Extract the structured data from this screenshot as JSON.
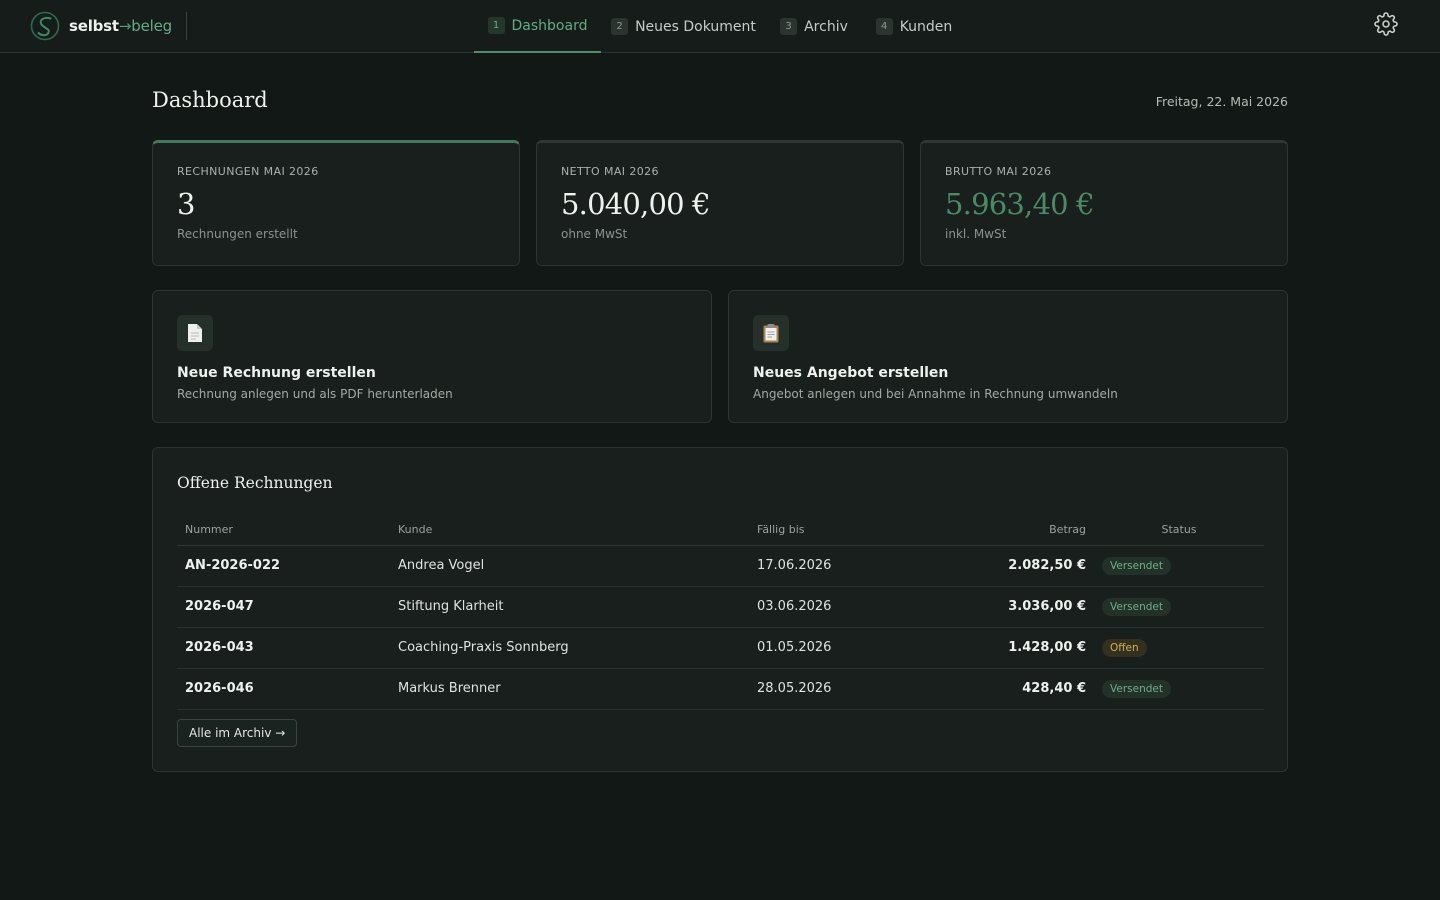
{
  "brand": {
    "part1": "selbst",
    "arrow": "→",
    "part2": "beleg"
  },
  "nav": [
    {
      "num": "1",
      "label": "Dashboard"
    },
    {
      "num": "2",
      "label": "Neues Dokument"
    },
    {
      "num": "3",
      "label": "Archiv"
    },
    {
      "num": "4",
      "label": "Kunden"
    }
  ],
  "page": {
    "title": "Dashboard",
    "date": "Freitag, 22. Mai 2026"
  },
  "stats": [
    {
      "label": "Rechnungen Mai 2026",
      "value": "3",
      "sub": "Rechnungen erstellt"
    },
    {
      "label": "Netto Mai 2026",
      "value": "5.040,00 €",
      "sub": "ohne MwSt"
    },
    {
      "label": "Brutto Mai 2026",
      "value": "5.963,40 €",
      "sub": "inkl. MwSt"
    }
  ],
  "actions": [
    {
      "title": "Neue Rechnung erstellen",
      "desc": "Rechnung anlegen und als PDF herunterladen"
    },
    {
      "title": "Neues Angebot erstellen",
      "desc": "Angebot anlegen und bei Annahme in Rechnung umwandeln"
    }
  ],
  "open_invoices": {
    "title": "Offene Rechnungen",
    "columns": [
      "Nummer",
      "Kunde",
      "Fällig bis",
      "Betrag",
      "Status"
    ],
    "rows": [
      {
        "number": "AN-2026-022",
        "customer": "Andrea Vogel",
        "due": "17.06.2026",
        "amount": "2.082,50 €",
        "status": "Versendet"
      },
      {
        "number": "2026-047",
        "customer": "Stiftung Klarheit",
        "due": "03.06.2026",
        "amount": "3.036,00 €",
        "status": "Versendet"
      },
      {
        "number": "2026-043",
        "customer": "Coaching-Praxis Sonnberg",
        "due": "01.05.2026",
        "amount": "1.428,00 €",
        "status": "Offen"
      },
      {
        "number": "2026-046",
        "customer": "Markus Brenner",
        "due": "28.05.2026",
        "amount": "428,40 €",
        "status": "Versendet"
      }
    ],
    "archive_button": "Alle im Archiv →"
  },
  "colors": {
    "accent": "#5fae84",
    "background": "#121815",
    "card": "#181f1c",
    "open_status": "#d3b050"
  }
}
